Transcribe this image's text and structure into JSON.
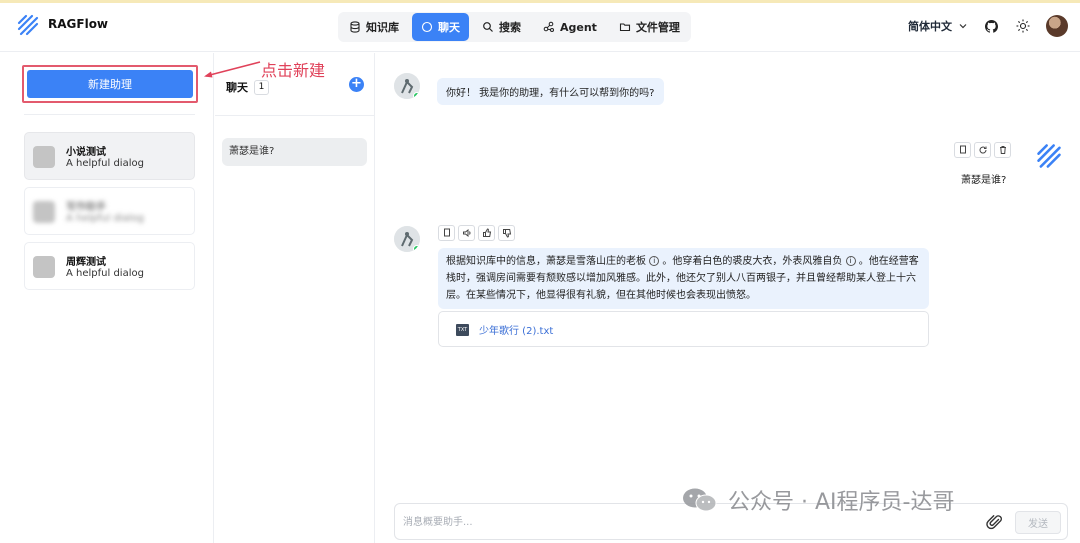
{
  "header": {
    "app_name": "RAGFlow",
    "nav": [
      {
        "label": "知识库",
        "icon": "database-icon",
        "active": false
      },
      {
        "label": "聊天",
        "icon": "chat-bubble-icon",
        "active": true
      },
      {
        "label": "搜索",
        "icon": "search-icon",
        "active": false
      },
      {
        "label": "Agent",
        "icon": "agent-graph-icon",
        "active": false
      },
      {
        "label": "文件管理",
        "icon": "folder-icon",
        "active": false
      }
    ],
    "language": "简体中文",
    "accent_color": "#3b82f6"
  },
  "sidebar": {
    "new_button_label": "新建助理",
    "assistants": [
      {
        "name": "小说测试",
        "description": "A helpful dialog",
        "selected": true,
        "blurred": false
      },
      {
        "name": "写作助手",
        "description": "A helpful dialog",
        "selected": false,
        "blurred": true
      },
      {
        "name": "周辉测试",
        "description": "A helpful dialog",
        "selected": false,
        "blurred": false
      }
    ]
  },
  "annotation": {
    "text": "点击新建",
    "color": "#e0425a"
  },
  "chat_list": {
    "title": "聊天",
    "count": "1",
    "conversations": [
      {
        "title": "萧瑟是谁?"
      }
    ]
  },
  "conversation": {
    "greeting": "你好！ 我是你的助理，有什么可以帮到你的吗?",
    "user_question": "萧瑟是谁?",
    "answer_part1": "根据知识库中的信息，萧瑟是雪落山庄的老板",
    "answer_part2": "。他穿着白色的裘皮大衣，外表风雅自负",
    "answer_part3": "。他在经营客栈时，强调房间需要有颓败感以增加风雅感。此外，他还欠了别人八百两银子，并且曾经帮助某人登上十六层。在某些情况下，他显得很有礼貌，但在其他时候也会表现出愤怒。",
    "info_glyph": "i",
    "file_type": "TXT",
    "file_name": "少年歌行 (2).txt"
  },
  "composer": {
    "placeholder": "消息概要助手...",
    "send_label": "发送"
  },
  "watermark": {
    "text": "公众号 · AI程序员-达哥"
  }
}
